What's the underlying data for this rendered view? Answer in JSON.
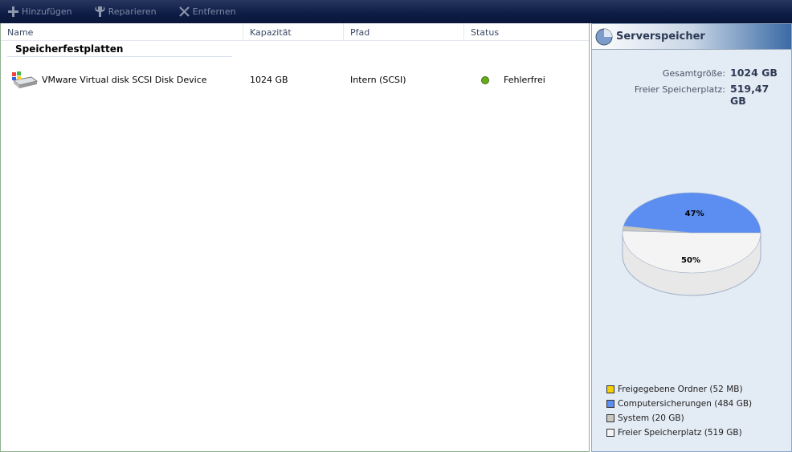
{
  "toolbar": {
    "add": "Hinzufügen",
    "repair": "Reparieren",
    "remove": "Entfernen"
  },
  "columns": [
    "Name",
    "Kapazität",
    "Pfad",
    "Status"
  ],
  "group": "Speicherfestplatten",
  "rows": [
    {
      "name": "VMware Virtual disk SCSI Disk Device",
      "capacity": "1024 GB",
      "path": "Intern (SCSI)",
      "status": "Fehlerfrei",
      "status_color": "#6aaa1a"
    }
  ],
  "side": {
    "title": "Serverspeicher",
    "total_label": "Gesamtgröße:",
    "total_value": "1024 GB",
    "free_label": "Freier Speicherplatz:",
    "free_value": "519,47 GB"
  },
  "chart_data": {
    "type": "pie",
    "slices": [
      {
        "label": "Computersicherungen (484 GB)",
        "value": 484,
        "pct_label": "47%",
        "color": "#5b8ef0"
      },
      {
        "label": "System (20 GB)",
        "value": 20,
        "pct_label": "",
        "color": "#c8c8c0"
      },
      {
        "label": "Freigegebene Ordner (52 MB)",
        "value": 0.05,
        "pct_label": "",
        "color": "#f5d000"
      },
      {
        "label": "Freier Speicherplatz (519 GB)",
        "value": 519,
        "pct_label": "50%",
        "color": "#f4f4f4"
      }
    ],
    "legend_order": [
      2,
      0,
      1,
      3
    ]
  }
}
